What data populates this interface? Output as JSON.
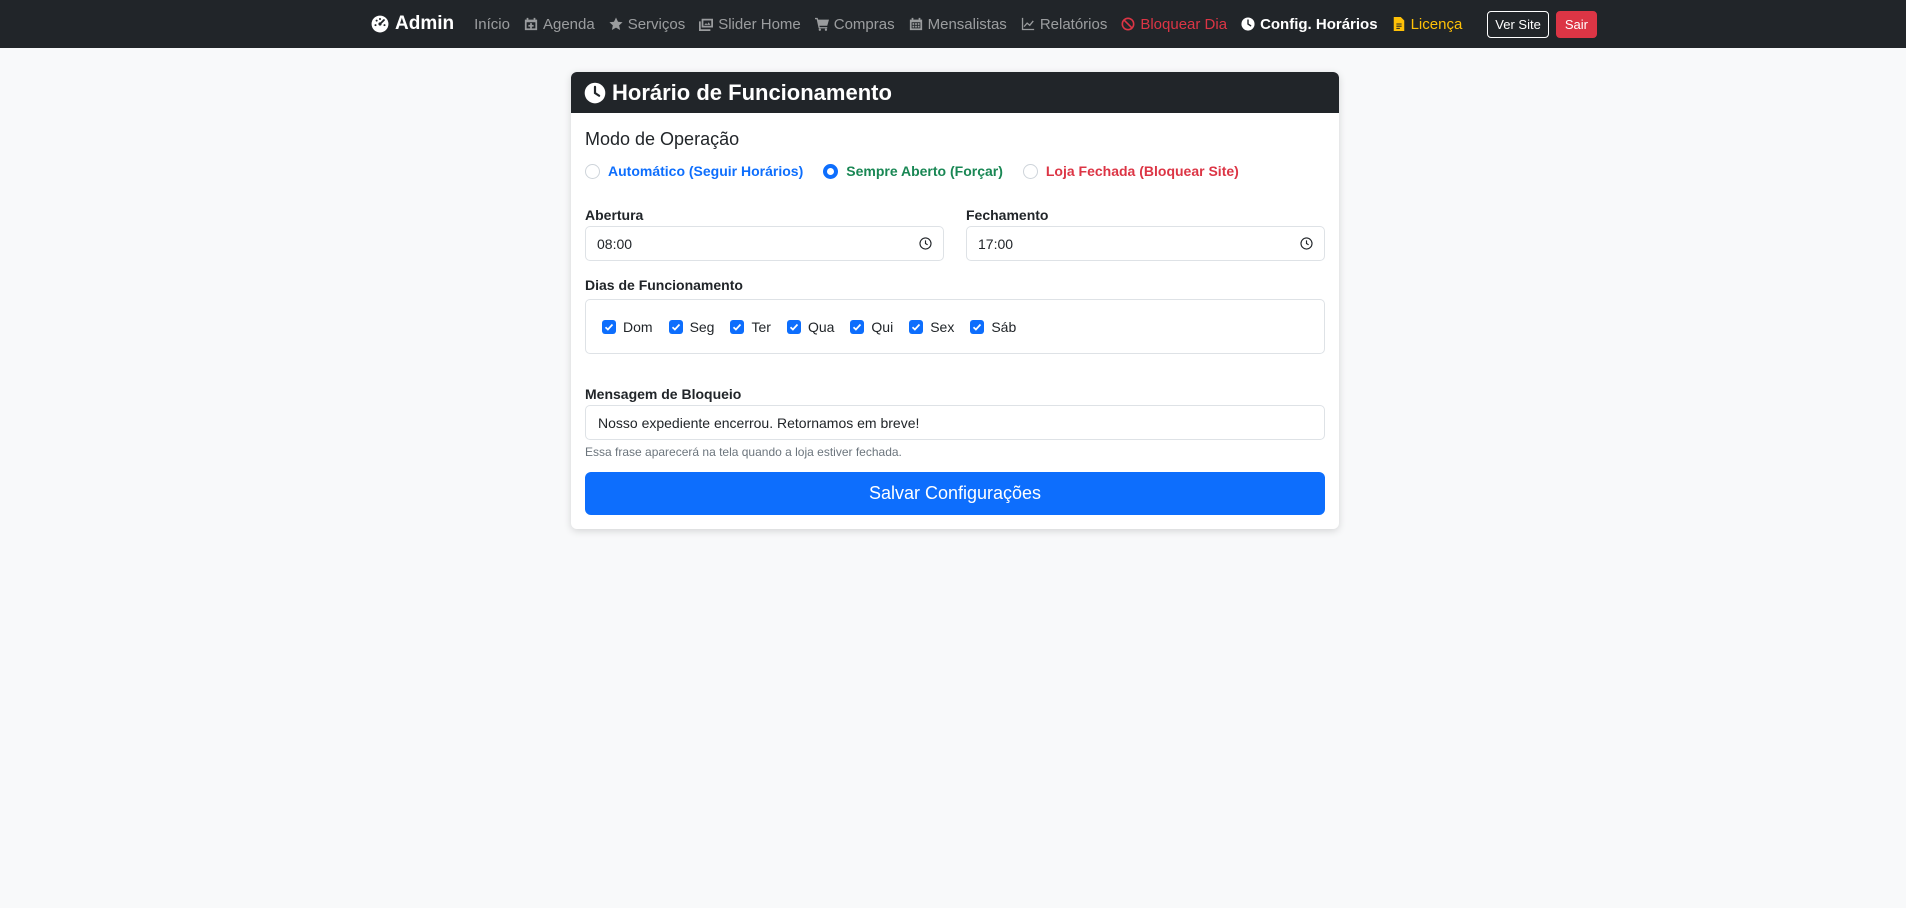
{
  "navbar": {
    "brand": "Admin",
    "items": [
      {
        "label": "Início",
        "icon": "none"
      },
      {
        "label": "Agenda",
        "icon": "calendar-plus-icon"
      },
      {
        "label": "Serviços",
        "icon": "star-icon"
      },
      {
        "label": "Slider Home",
        "icon": "images-icon"
      },
      {
        "label": "Compras",
        "icon": "cart-icon"
      },
      {
        "label": "Mensalistas",
        "icon": "calendar-icon"
      },
      {
        "label": "Relatórios",
        "icon": "chart-line-icon"
      },
      {
        "label": "Bloquear Dia",
        "icon": "ban-icon"
      },
      {
        "label": "Config. Horários",
        "icon": "clock-icon"
      },
      {
        "label": "Licença",
        "icon": "file-icon"
      }
    ],
    "ver_site": "Ver Site",
    "sair": "Sair"
  },
  "card": {
    "title": "Horário de Funcionamento",
    "mode_title": "Modo de Operação",
    "modes": [
      {
        "label": "Automático (Seguir Horários)",
        "checked": false
      },
      {
        "label": "Sempre Aberto (Forçar)",
        "checked": true
      },
      {
        "label": "Loja Fechada (Bloquear Site)",
        "checked": false
      }
    ],
    "opening_label": "Abertura",
    "opening_value": "08:00",
    "closing_label": "Fechamento",
    "closing_value": "17:00",
    "days_label": "Dias de Funcionamento",
    "days": [
      "Dom",
      "Seg",
      "Ter",
      "Qua",
      "Qui",
      "Sex",
      "Sáb"
    ],
    "message_label": "Mensagem de Bloqueio",
    "message_value": "Nosso expediente encerrou. Retornamos em breve!",
    "message_help": "Essa frase aparecerá na tela quando a loja estiver fechada.",
    "save_label": "Salvar Configurações"
  },
  "colors": {
    "primary": "#0d6efd",
    "success": "#198754",
    "danger": "#dc3545",
    "warning": "#ffc107",
    "dark": "#212529"
  }
}
